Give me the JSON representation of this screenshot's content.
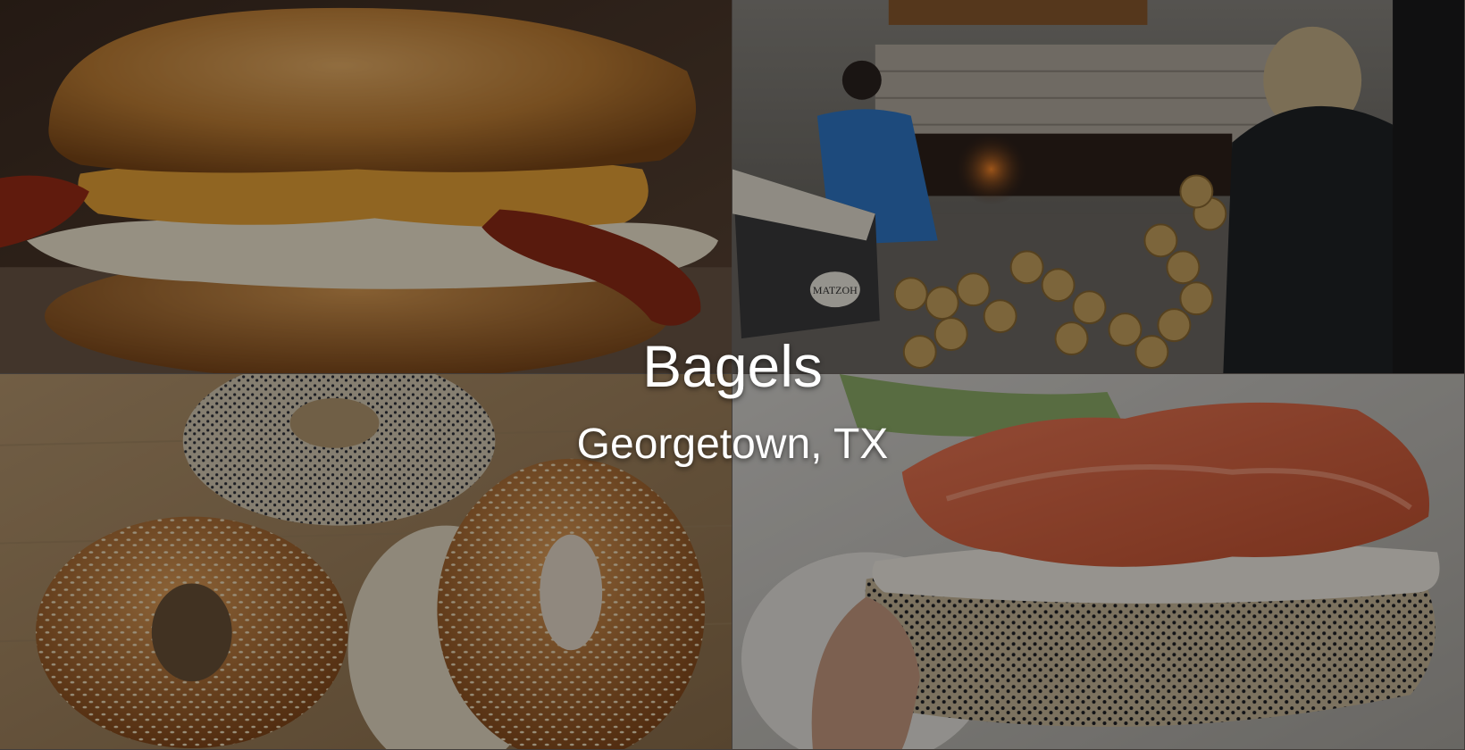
{
  "hero": {
    "title": "Bagels",
    "subtitle": "Georgetown, TX"
  },
  "photos": [
    {
      "icon": "breakfast-sandwich-photo"
    },
    {
      "icon": "bagel-bakery-oven-photo"
    },
    {
      "icon": "assorted-bagels-photo"
    },
    {
      "icon": "lox-bagel-photo"
    }
  ],
  "basket_sign": "MATZOH",
  "colors": {
    "overlay": "#000000",
    "text": "#ffffff",
    "bagel_crust": "#b9782f",
    "lox": "#d9674a",
    "cream_cheese": "#f2eee6"
  }
}
